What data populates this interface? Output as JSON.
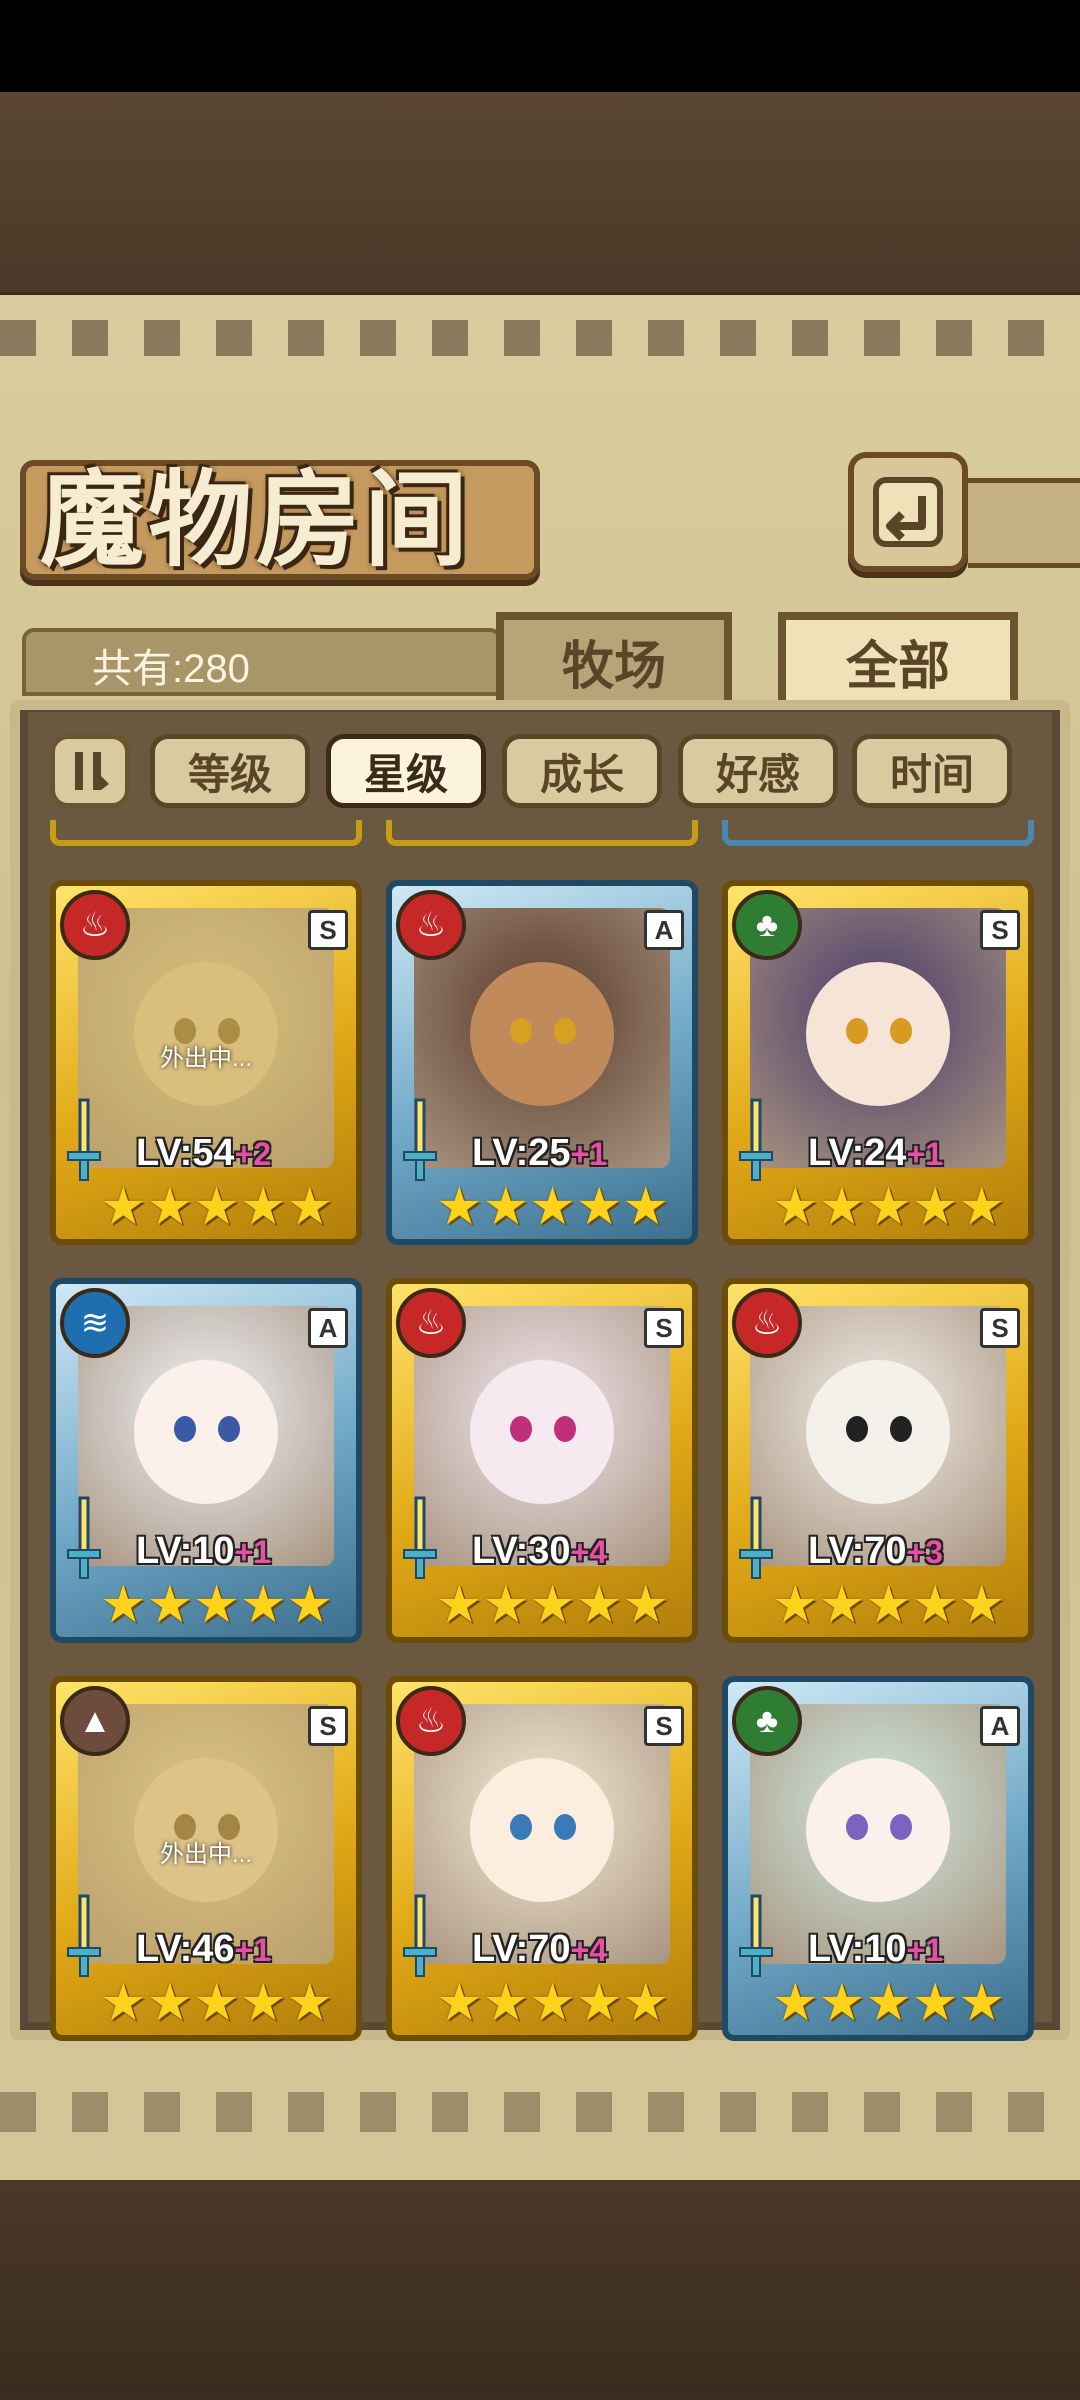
{
  "header": {
    "title": "魔物房间"
  },
  "count_label": "共有:280",
  "tabs": [
    {
      "label": "牧场"
    },
    {
      "label": "全部",
      "active": true
    }
  ],
  "sort_buttons": [
    {
      "label": "等级"
    },
    {
      "label": "星级",
      "active": true
    },
    {
      "label": "成长"
    },
    {
      "label": "好感"
    },
    {
      "label": "时间"
    }
  ],
  "cards": [
    {
      "element": "fire",
      "rank": "S",
      "level": "LV:54",
      "plus": "+2",
      "stars": 5,
      "away": "外出中...",
      "frame": "gold"
    },
    {
      "element": "fire",
      "rank": "A",
      "level": "LV:25",
      "plus": "+1",
      "stars": 5,
      "away": "",
      "frame": "blue"
    },
    {
      "element": "nature",
      "rank": "S",
      "level": "LV:24",
      "plus": "+1",
      "stars": 5,
      "away": "",
      "frame": "gold"
    },
    {
      "element": "water",
      "rank": "A",
      "level": "LV:10",
      "plus": "+1",
      "stars": 5,
      "away": "",
      "frame": "blue"
    },
    {
      "element": "fire",
      "rank": "S",
      "level": "LV:30",
      "plus": "+4",
      "stars": 5,
      "away": "",
      "frame": "gold"
    },
    {
      "element": "fire",
      "rank": "S",
      "level": "LV:70",
      "plus": "+3",
      "stars": 5,
      "away": "",
      "frame": "gold"
    },
    {
      "element": "earth",
      "rank": "S",
      "level": "LV:46",
      "plus": "+1",
      "stars": 5,
      "away": "外出中...",
      "frame": "gold"
    },
    {
      "element": "fire",
      "rank": "S",
      "level": "LV:70",
      "plus": "+4",
      "stars": 5,
      "away": "",
      "frame": "gold"
    },
    {
      "element": "nature",
      "rank": "A",
      "level": "LV:10",
      "plus": "+1",
      "stars": 5,
      "away": "",
      "frame": "blue"
    }
  ],
  "icons": {
    "back": "back-arrow-icon",
    "filter": "filter-toggle-icon",
    "fire": "fire-element-icon",
    "nature": "leaf-element-icon",
    "water": "water-element-icon",
    "earth": "earth-element-icon",
    "sword": "sword-icon",
    "star": "star-icon"
  }
}
